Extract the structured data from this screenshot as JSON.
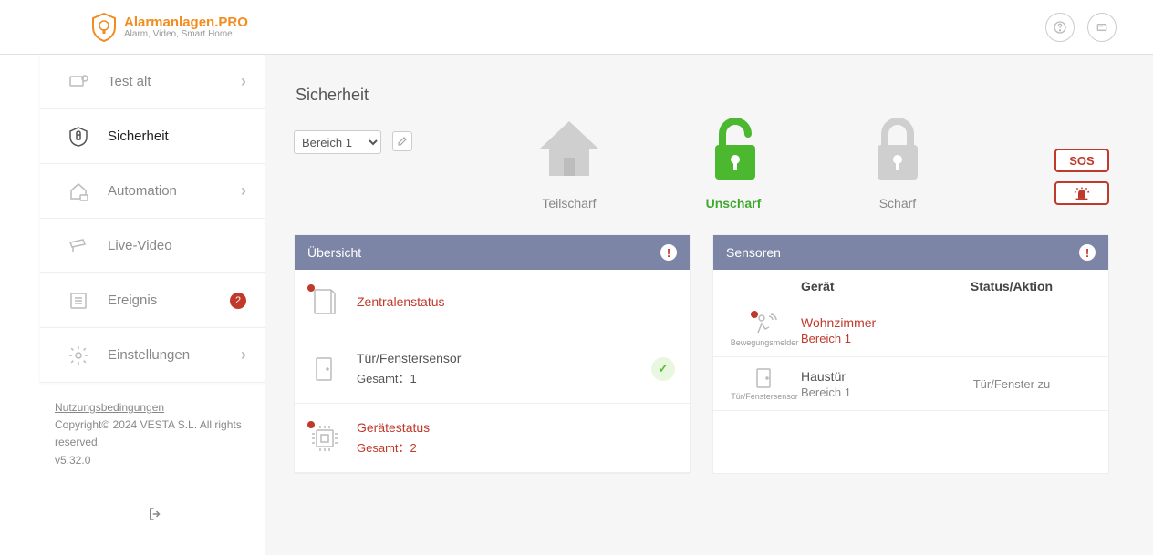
{
  "brand": {
    "name": "Alarmanlagen.PRO",
    "tagline": "Alarm, Video, Smart Home"
  },
  "sidebar": {
    "items": [
      {
        "label": "Test alt",
        "chevron": true
      },
      {
        "label": "Sicherheit",
        "chevron": false
      },
      {
        "label": "Automation",
        "chevron": true
      },
      {
        "label": "Live-Video",
        "chevron": false
      },
      {
        "label": "Ereignis",
        "badge": "2"
      },
      {
        "label": "Einstellungen",
        "chevron": true
      }
    ],
    "footer": {
      "terms": "Nutzungsbedingungen",
      "copyright": "Copyright© 2024 VESTA S.L. All rights reserved.",
      "version": "v5.32.0"
    }
  },
  "page": {
    "title": "Sicherheit",
    "area_selected": "Bereich 1",
    "modes": {
      "partial": "Teilscharf",
      "disarm": "Unscharf",
      "arm": "Scharf"
    },
    "sos_label": "SOS"
  },
  "overview": {
    "title": "Übersicht",
    "rows": [
      {
        "title": "Zentralenstatus",
        "alert": true
      },
      {
        "title": "Tür/Fenstersensor",
        "count_label": "Gesamt：1",
        "ok": true
      },
      {
        "title": "Gerätestatus",
        "count_label": "Gesamt：2",
        "alert": true
      }
    ]
  },
  "sensors": {
    "title": "Sensoren",
    "columns": {
      "device": "Gerät",
      "status": "Status/Aktion"
    },
    "rows": [
      {
        "type": "Bewegungsmelder",
        "name": "Wohnzimmer",
        "area": "Bereich 1",
        "status": "",
        "alert": true
      },
      {
        "type": "Tür/Fenstersensor",
        "name": "Haustür",
        "area": "Bereich 1",
        "status": "Tür/Fenster zu",
        "alert": false
      }
    ]
  }
}
